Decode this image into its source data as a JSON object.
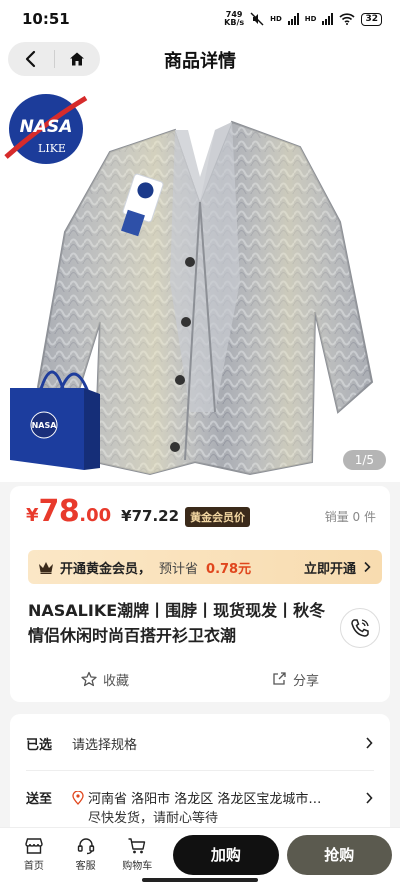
{
  "status": {
    "time": "10:51",
    "speed_top": "749",
    "speed_bottom": "KB/s",
    "net1": "HD",
    "net2": "HD",
    "battery": "32"
  },
  "header": {
    "title": "商品详情"
  },
  "hero": {
    "counter": "1/5",
    "logo_top": "NASA",
    "logo_bottom": "LIKE",
    "bag_text": "NASA"
  },
  "price": {
    "currency": "¥",
    "int": "78",
    "dec": ".00",
    "member_price": "¥77.22",
    "member_badge": "黄金会员价",
    "sales": "销量 0 件"
  },
  "gold": {
    "label": "开通黄金会员，",
    "est": "预计省",
    "save": "0.78元",
    "cta": "立即开通"
  },
  "product_title": "NASALIKE潮牌丨围脖丨现货现发丨秋冬情侣休闲时尚百搭开衫卫衣潮",
  "actions": {
    "favorite": "收藏",
    "share": "分享"
  },
  "spec": {
    "selected_label": "已选",
    "selected_value": "请选择规格",
    "ship_label": "送至",
    "address": "河南省 洛阳市 洛龙区 洛龙区宝龙城市…",
    "ship_note": "尽快发货，请耐心等待"
  },
  "bottom": {
    "home": "首页",
    "service": "客服",
    "cart": "购物车",
    "add_cart": "加购",
    "buy": "抢购"
  }
}
